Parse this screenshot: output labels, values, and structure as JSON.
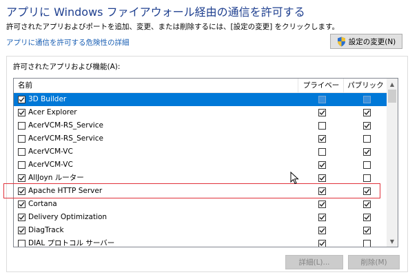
{
  "header": {
    "title": "アプリに Windows ファイアウォール経由の通信を許可する",
    "description": "許可されたアプリおよびポートを追加、変更、または削除するには、[設定の変更] をクリックします。",
    "risk_link": "アプリに通信を許可する危険性の詳細",
    "change_settings_label": "設定の変更(N)"
  },
  "group": {
    "label": "許可されたアプリおよび機能(A):"
  },
  "table": {
    "columns": {
      "name": "名前",
      "private": "プライベート",
      "public": "パブリック"
    },
    "rows": [
      {
        "name": "3D Builder",
        "enabled": true,
        "private": false,
        "public": false,
        "selected": true
      },
      {
        "name": "Acer Explorer",
        "enabled": true,
        "private": true,
        "public": true
      },
      {
        "name": "AcerVCM-RS_Service",
        "enabled": false,
        "private": false,
        "public": true
      },
      {
        "name": "AcerVCM-RS_Service",
        "enabled": false,
        "private": true,
        "public": false
      },
      {
        "name": "AcerVCM-VC",
        "enabled": false,
        "private": false,
        "public": true
      },
      {
        "name": "AcerVCM-VC",
        "enabled": false,
        "private": true,
        "public": false
      },
      {
        "name": "AllJoyn ルーター",
        "enabled": true,
        "private": true,
        "public": false
      },
      {
        "name": "Apache HTTP Server",
        "enabled": true,
        "private": true,
        "public": true
      },
      {
        "name": "Cortana",
        "enabled": true,
        "private": true,
        "public": true
      },
      {
        "name": "Delivery Optimization",
        "enabled": true,
        "private": true,
        "public": true
      },
      {
        "name": "DiagTrack",
        "enabled": true,
        "private": true,
        "public": true
      },
      {
        "name": "DIAL プロトコル サーバー",
        "enabled": false,
        "private": true,
        "public": false
      }
    ]
  },
  "footer": {
    "details_label": "詳細(L)...",
    "remove_label": "削除(M)"
  },
  "colors": {
    "title": "#1e3f8f",
    "link": "#1a5fb4",
    "selection": "#0078d7",
    "highlight_box": "#e0303a"
  }
}
